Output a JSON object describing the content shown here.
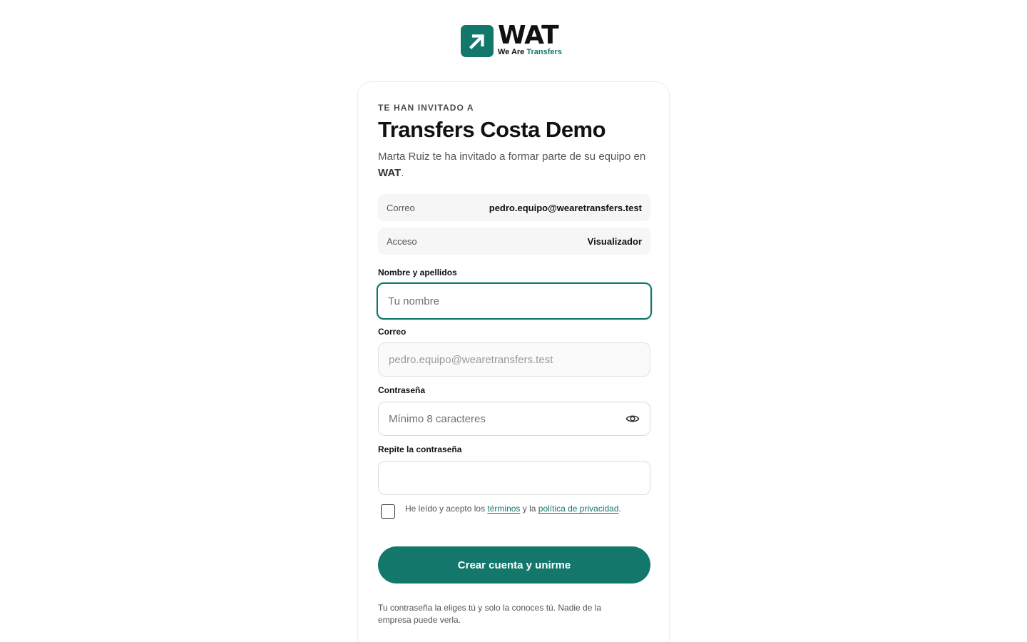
{
  "brand": {
    "name": "WAT",
    "tagline_part1": "We Are",
    "tagline_part2": "Transfers",
    "accent_color": "#13776c"
  },
  "invite": {
    "eyebrow": "TE HAN INVITADO A",
    "company": "Transfers Costa Demo",
    "message_part1": "Marta Ruiz te ha invitado a formar parte de su equipo en ",
    "message_brand": "WAT",
    "message_end": "."
  },
  "info": [
    {
      "key": "Correo",
      "value": "pedro.equipo@wearetransfers.test"
    },
    {
      "key": "Acceso",
      "value": "Visualizador"
    }
  ],
  "form": {
    "name_label": "Nombre y apellidos",
    "name_placeholder": "Tu nombre",
    "email_label": "Correo",
    "email_value": "pedro.equipo@wearetransfers.test",
    "password_label": "Contraseña",
    "password_placeholder": "Mínimo 8 caracteres",
    "repeat_label": "Repite la contraseña",
    "repeat_placeholder": "",
    "terms_prefix": "He leído y acepto los ",
    "terms_link": "términos",
    "terms_middle": " y la ",
    "privacy_link": "política de privacidad",
    "terms_end": ".",
    "submit_label": "Crear cuenta y unirme",
    "footnote": "Tu contraseña la eliges tú y solo la conoces tú. Nadie de la empresa puede verla."
  }
}
